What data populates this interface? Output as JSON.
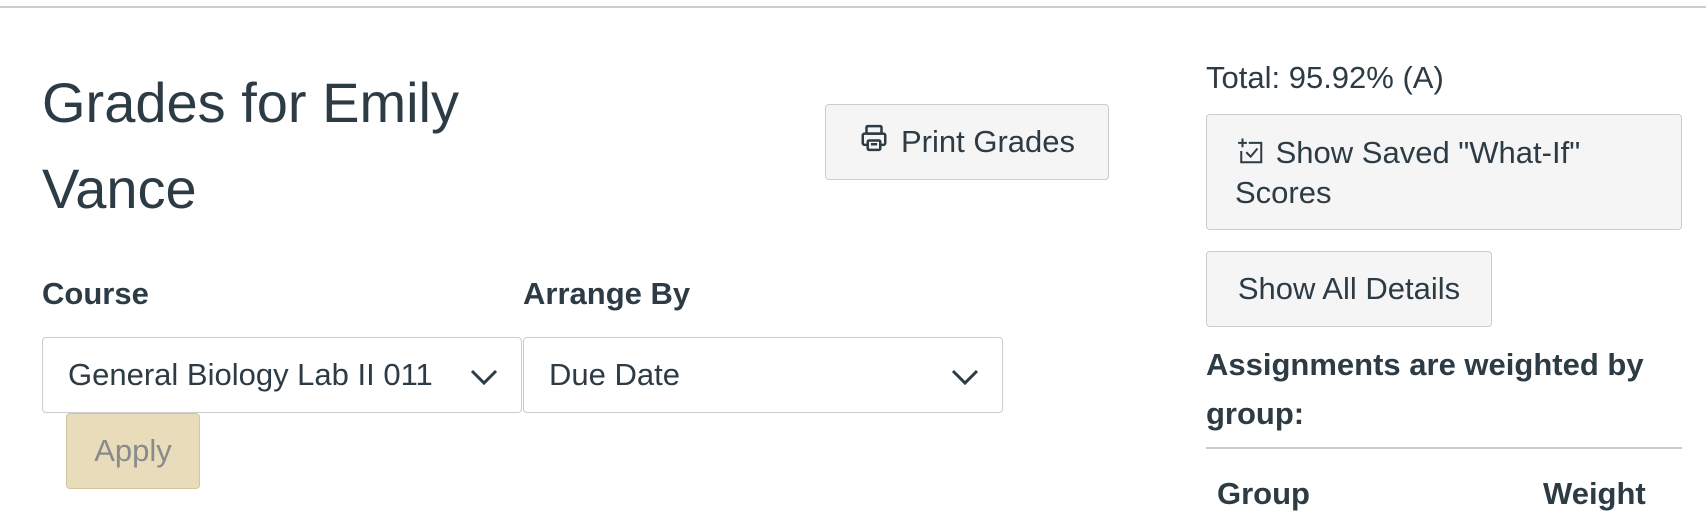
{
  "page": {
    "title": "Grades for Emily Vance"
  },
  "toolbar": {
    "print_label": "Print Grades"
  },
  "filters": {
    "course_label": "Course",
    "course_value": "General Biology Lab II 011",
    "arrange_label": "Arrange By",
    "arrange_value": "Due Date",
    "apply_label": "Apply"
  },
  "sidebar": {
    "total": "Total: 95.92% (A)",
    "whatif_label": "Show Saved \"What-If\" Scores",
    "details_label": "Show All Details",
    "weighted_note": "Assignments are weighted by group:",
    "table_headers": [
      "Group",
      "Weight"
    ]
  },
  "colors": {
    "text": "#2d3b45",
    "apply_bg": "#e8dcbb",
    "border": "#c7cdd1"
  },
  "icons": {
    "print": "printer-icon",
    "whatif": "what-if-icon",
    "chevron": "chevron-down-icon"
  }
}
